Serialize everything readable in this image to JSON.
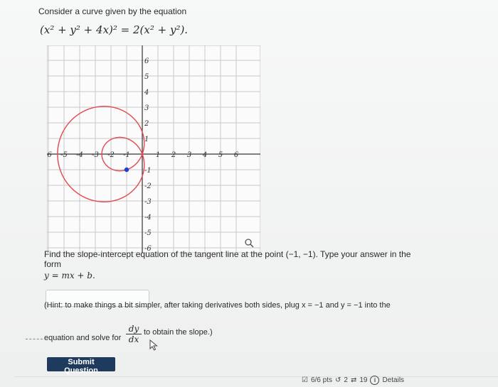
{
  "problem": {
    "prompt": "Consider a curve given by the equation",
    "equation": "(x² + y² + 4x)² = 2(x² + y²).",
    "question_text": "Find the slope-intercept equation of the tangent line at the point (−1, −1). Type your answer in the form",
    "question_form": "y = mx + b.",
    "answer_value": "",
    "hint_line1": "(Hint: to make things a bit simpler, after taking derivatives both sides, plug x = −1 and y = −1 into the",
    "hint_line2": "equation and solve for",
    "fraction_num": "dy",
    "fraction_den": "dx",
    "hint_line3": "to obtain the slope.)",
    "submit_label": "Submit Question"
  },
  "footer": {
    "points": "6/6 pts",
    "retries": "2",
    "attempts": "19",
    "details": "Details"
  },
  "chart_data": {
    "type": "line",
    "title": "",
    "xlabel": "",
    "ylabel": "",
    "xlim": [
      -6.5,
      6.5
    ],
    "ylim": [
      -6.5,
      6.5
    ],
    "grid": true,
    "x_ticks": [
      "-6",
      "-5",
      "-4",
      "-3",
      "-2",
      "-1",
      "1",
      "2",
      "3",
      "4",
      "5",
      "6"
    ],
    "y_ticks": [
      "6",
      "5",
      "4",
      "3",
      "2",
      "1",
      "-1",
      "-2",
      "-3",
      "-4",
      "-5",
      "-6"
    ],
    "curve": "(x^2 + y^2 + 4x)^2 = 2(x^2 + y^2)",
    "highlight_point": {
      "x": -1,
      "y": -1
    },
    "colors": {
      "curve": "#e0505a",
      "point": "#1c3fd6",
      "grid": "#c8c8c8",
      "axis": "#333333"
    }
  }
}
